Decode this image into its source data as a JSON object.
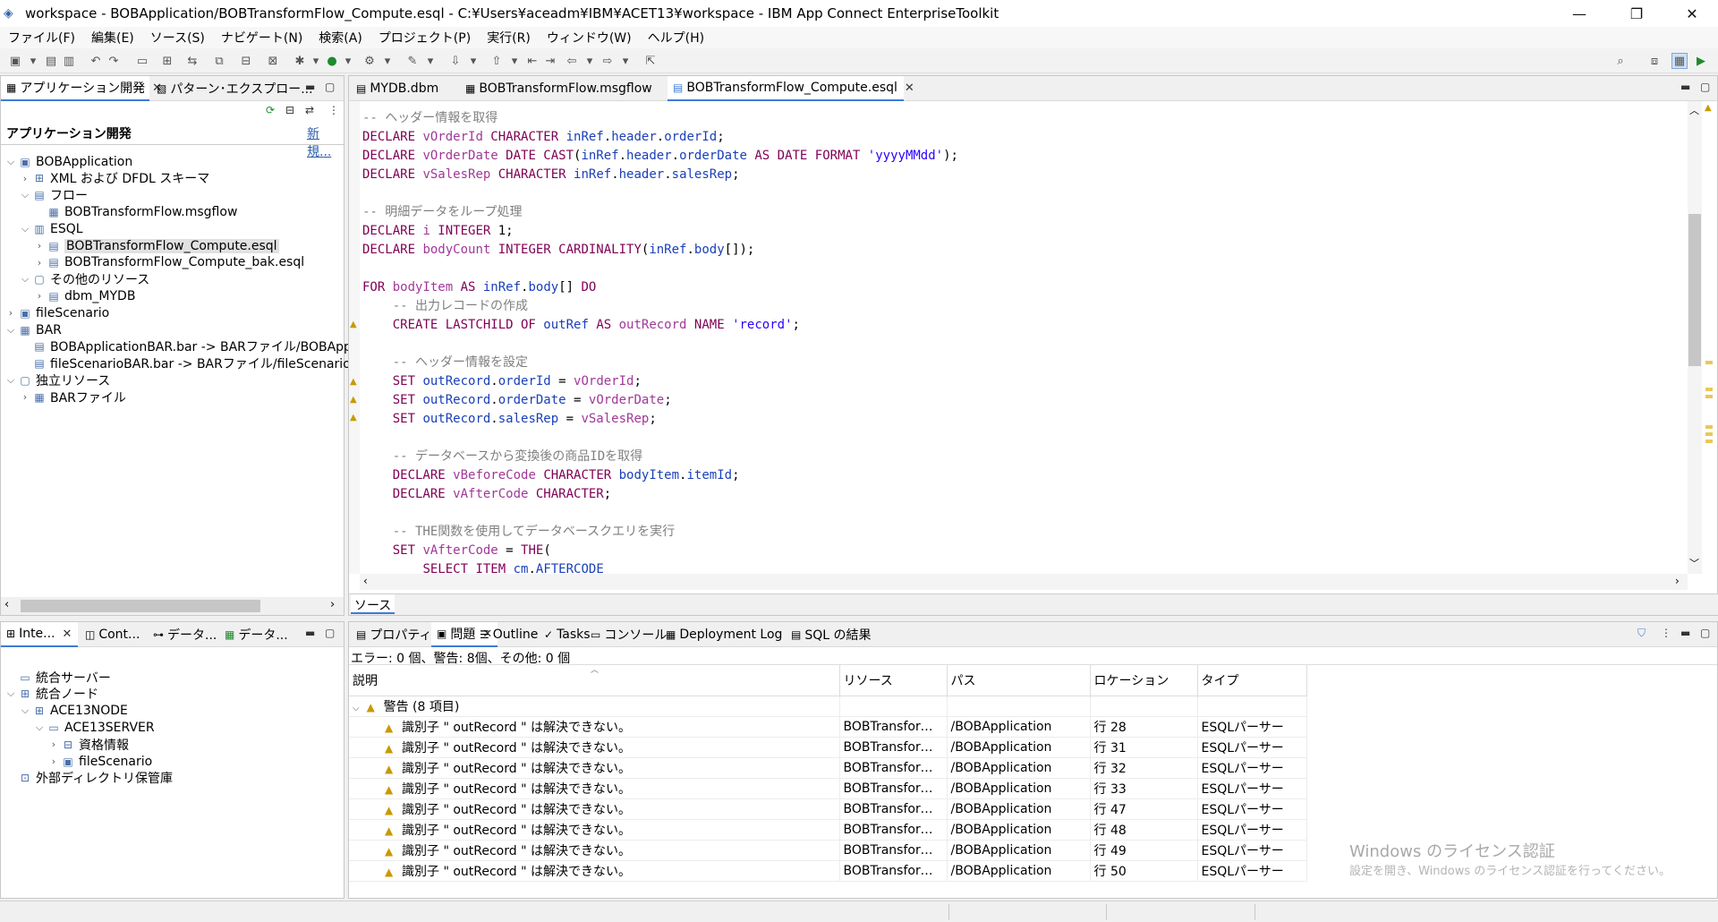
{
  "window": {
    "title": "workspace - BOBApplication/BOBTransformFlow_Compute.esql - C:¥Users¥aceadm¥IBM¥ACET13¥workspace - IBM App Connect EnterpriseToolkit",
    "minimize": "—",
    "restore": "❐",
    "close": "✕"
  },
  "menu": [
    "ファイル(F)",
    "編集(E)",
    "ソース(S)",
    "ナビゲート(N)",
    "検索(A)",
    "プロジェクト(P)",
    "実行(R)",
    "ウィンドウ(W)",
    "ヘルプ(H)"
  ],
  "left_top": {
    "tabs": [
      {
        "label": "アプリケーション開発",
        "icon": "app-dev-icon"
      },
      {
        "label": "パターン･エクスプロー...",
        "icon": "pattern-icon"
      }
    ],
    "header": "アプリケーション開発",
    "new_link": "新規...",
    "tree": [
      {
        "label": "BOBApplication",
        "level": 0,
        "expanded": true,
        "icon": "application-icon"
      },
      {
        "label": "XML および DFDL スキーマ",
        "level": 1,
        "expanded": false,
        "icon": "schema-icon"
      },
      {
        "label": "フロー",
        "level": 1,
        "expanded": true,
        "icon": "flow-folder-icon"
      },
      {
        "label": "BOBTransformFlow.msgflow",
        "level": 2,
        "expanded": null,
        "icon": "msgflow-icon"
      },
      {
        "label": "ESQL",
        "level": 1,
        "expanded": true,
        "icon": "esql-folder-icon"
      },
      {
        "label": "BOBTransformFlow_Compute.esql",
        "level": 2,
        "expanded": false,
        "icon": "esql-file-icon",
        "selected": true
      },
      {
        "label": "BOBTransformFlow_Compute_bak.esql",
        "level": 2,
        "expanded": false,
        "icon": "esql-file-icon"
      },
      {
        "label": "その他のリソース",
        "level": 1,
        "expanded": true,
        "icon": "resource-folder-icon"
      },
      {
        "label": "dbm_MYDB",
        "level": 2,
        "expanded": false,
        "icon": "dbm-icon"
      },
      {
        "label": "fileScenario",
        "level": 0,
        "expanded": false,
        "icon": "application-icon"
      },
      {
        "label": "BAR",
        "level": 0,
        "expanded": true,
        "icon": "bar-folder-icon"
      },
      {
        "label": "BOBApplicationBAR.bar -> BARファイル/BOBApp",
        "level": 1,
        "expanded": null,
        "icon": "bar-file-icon"
      },
      {
        "label": "fileScenarioBAR.bar -> BARファイル/fileScenarioB",
        "level": 1,
        "expanded": null,
        "icon": "bar-file-icon"
      },
      {
        "label": "独立リソース",
        "level": 0,
        "expanded": true,
        "icon": "resource-folder-icon"
      },
      {
        "label": "BARファイル",
        "level": 1,
        "expanded": false,
        "icon": "bar-folder-icon"
      }
    ]
  },
  "left_bottom": {
    "tabs": [
      {
        "label": "Inte...",
        "icon": "integration-icon"
      },
      {
        "label": "Cont...",
        "icon": "container-icon"
      },
      {
        "label": "データ...",
        "icon": "data-icon"
      },
      {
        "label": "データ...",
        "icon": "data2-icon"
      }
    ],
    "tree": [
      {
        "label": "統合サーバー",
        "level": 0,
        "expanded": null,
        "icon": "server-icon"
      },
      {
        "label": "統合ノード",
        "level": 0,
        "expanded": true,
        "icon": "node-icon"
      },
      {
        "label": "ACE13NODE",
        "level": 1,
        "expanded": true,
        "icon": "node-icon"
      },
      {
        "label": "ACE13SERVER",
        "level": 2,
        "expanded": true,
        "icon": "server-icon"
      },
      {
        "label": "資格情報",
        "level": 3,
        "expanded": false,
        "icon": "credentials-icon"
      },
      {
        "label": "fileScenario",
        "level": 3,
        "expanded": false,
        "icon": "application-icon"
      },
      {
        "label": "外部ディレクトリ保管庫",
        "level": 0,
        "expanded": null,
        "icon": "lock-icon"
      }
    ]
  },
  "editor": {
    "tabs": [
      {
        "label": "MYDB.dbm",
        "icon": "dbm-icon"
      },
      {
        "label": "BOBTransformFlow.msgflow",
        "icon": "msgflow-icon"
      },
      {
        "label": "BOBTransformFlow_Compute.esql",
        "icon": "esql-file-icon",
        "active": true
      }
    ],
    "bottom_tab": "ソース",
    "lines": [
      [
        [
          "cm",
          "-- ヘッダー情報を取得"
        ]
      ],
      [
        [
          "kw",
          "DECLARE "
        ],
        [
          "vr",
          "vOrderId "
        ],
        [
          "kw",
          "CHARACTER "
        ],
        [
          "id",
          "inRef"
        ],
        [
          "pl",
          "."
        ],
        [
          "id",
          "header"
        ],
        [
          "pl",
          "."
        ],
        [
          "id",
          "orderId"
        ],
        [
          "pl",
          ";"
        ]
      ],
      [
        [
          "kw",
          "DECLARE "
        ],
        [
          "vr",
          "vOrderDate "
        ],
        [
          "kw",
          "DATE CAST"
        ],
        [
          "pl",
          "("
        ],
        [
          "id",
          "inRef"
        ],
        [
          "pl",
          "."
        ],
        [
          "id",
          "header"
        ],
        [
          "pl",
          "."
        ],
        [
          "id",
          "orderDate "
        ],
        [
          "kw",
          "AS DATE FORMAT "
        ],
        [
          "st",
          "'yyyyMMdd'"
        ],
        [
          "pl",
          ");"
        ]
      ],
      [
        [
          "kw",
          "DECLARE "
        ],
        [
          "vr",
          "vSalesRep "
        ],
        [
          "kw",
          "CHARACTER "
        ],
        [
          "id",
          "inRef"
        ],
        [
          "pl",
          "."
        ],
        [
          "id",
          "header"
        ],
        [
          "pl",
          "."
        ],
        [
          "id",
          "salesRep"
        ],
        [
          "pl",
          ";"
        ]
      ],
      [],
      [
        [
          "cm",
          "-- 明細データをループ処理"
        ]
      ],
      [
        [
          "kw",
          "DECLARE "
        ],
        [
          "vr",
          "i "
        ],
        [
          "kw",
          "INTEGER "
        ],
        [
          "pl",
          "1;"
        ]
      ],
      [
        [
          "kw",
          "DECLARE "
        ],
        [
          "vr",
          "bodyCount "
        ],
        [
          "kw",
          "INTEGER CARDINALITY"
        ],
        [
          "pl",
          "("
        ],
        [
          "id",
          "inRef"
        ],
        [
          "pl",
          "."
        ],
        [
          "id",
          "body"
        ],
        [
          "pl",
          "[]);"
        ]
      ],
      [],
      [
        [
          "kw",
          "FOR "
        ],
        [
          "vr",
          "bodyItem "
        ],
        [
          "kw",
          "AS "
        ],
        [
          "id",
          "inRef"
        ],
        [
          "pl",
          "."
        ],
        [
          "id",
          "body"
        ],
        [
          "pl",
          "[] "
        ],
        [
          "kw",
          "DO"
        ]
      ],
      [
        [
          "pl",
          "    "
        ],
        [
          "cm",
          "-- 出力レコードの作成"
        ]
      ],
      [
        [
          "pl",
          "    "
        ],
        [
          "kw",
          "CREATE LASTCHILD OF "
        ],
        [
          "id",
          "outRef "
        ],
        [
          "kw",
          "AS "
        ],
        [
          "vr",
          "outRecord "
        ],
        [
          "kw",
          "NAME "
        ],
        [
          "st",
          "'record'"
        ],
        [
          "pl",
          ";"
        ]
      ],
      [],
      [
        [
          "pl",
          "    "
        ],
        [
          "cm",
          "-- ヘッダー情報を設定"
        ]
      ],
      [
        [
          "pl",
          "    "
        ],
        [
          "kw",
          "SET "
        ],
        [
          "id",
          "outRecord"
        ],
        [
          "pl",
          "."
        ],
        [
          "id",
          "orderId "
        ],
        [
          "pl",
          "= "
        ],
        [
          "vr",
          "vOrderId"
        ],
        [
          "pl",
          ";"
        ]
      ],
      [
        [
          "pl",
          "    "
        ],
        [
          "kw",
          "SET "
        ],
        [
          "id",
          "outRecord"
        ],
        [
          "pl",
          "."
        ],
        [
          "id",
          "orderDate "
        ],
        [
          "pl",
          "= "
        ],
        [
          "vr",
          "vOrderDate"
        ],
        [
          "pl",
          ";"
        ]
      ],
      [
        [
          "pl",
          "    "
        ],
        [
          "kw",
          "SET "
        ],
        [
          "id",
          "outRecord"
        ],
        [
          "pl",
          "."
        ],
        [
          "id",
          "salesRep "
        ],
        [
          "pl",
          "= "
        ],
        [
          "vr",
          "vSalesRep"
        ],
        [
          "pl",
          ";"
        ]
      ],
      [],
      [
        [
          "pl",
          "    "
        ],
        [
          "cm",
          "-- データベースから変換後の商品IDを取得"
        ]
      ],
      [
        [
          "pl",
          "    "
        ],
        [
          "kw",
          "DECLARE "
        ],
        [
          "vr",
          "vBeforeCode "
        ],
        [
          "kw",
          "CHARACTER "
        ],
        [
          "id",
          "bodyItem"
        ],
        [
          "pl",
          "."
        ],
        [
          "id",
          "itemId"
        ],
        [
          "pl",
          ";"
        ]
      ],
      [
        [
          "pl",
          "    "
        ],
        [
          "kw",
          "DECLARE "
        ],
        [
          "vr",
          "vAfterCode "
        ],
        [
          "kw",
          "CHARACTER"
        ],
        [
          "pl",
          ";"
        ]
      ],
      [],
      [
        [
          "pl",
          "    "
        ],
        [
          "cm",
          "-- THE関数を使用してデータベースクエリを実行"
        ]
      ],
      [
        [
          "pl",
          "    "
        ],
        [
          "kw",
          "SET "
        ],
        [
          "vr",
          "vAfterCode "
        ],
        [
          "pl",
          "= "
        ],
        [
          "kw",
          "THE"
        ],
        [
          "pl",
          "("
        ]
      ],
      [
        [
          "pl",
          "        "
        ],
        [
          "kw",
          "SELECT ITEM "
        ],
        [
          "id",
          "cm"
        ],
        [
          "pl",
          "."
        ],
        [
          "id",
          "AFTERCODE"
        ]
      ]
    ]
  },
  "bottom": {
    "tabs": [
      {
        "label": "プロパティー",
        "icon": "properties-icon"
      },
      {
        "label": "問題",
        "icon": "problems-icon",
        "active": true
      },
      {
        "label": "Outline",
        "icon": "outline-icon"
      },
      {
        "label": "Tasks",
        "icon": "tasks-icon"
      },
      {
        "label": "コンソール",
        "icon": "console-icon"
      },
      {
        "label": "Deployment Log",
        "icon": "log-icon"
      },
      {
        "label": "SQL の結果",
        "icon": "sql-icon"
      }
    ],
    "summary": "エラー: 0 個、警告: 8個、その他: 0 個",
    "columns": [
      "説明",
      "リソース",
      "パス",
      "ロケーション",
      "タイプ"
    ],
    "group": "警告 (8 項目)",
    "rows": [
      {
        "desc": "識別子 \" outRecord \" は解決できない。",
        "resource": "BOBTransformF...",
        "path": "/BOBApplication",
        "location": "行 28",
        "type": "ESQLパーサー"
      },
      {
        "desc": "識別子 \" outRecord \" は解決できない。",
        "resource": "BOBTransformF...",
        "path": "/BOBApplication",
        "location": "行 31",
        "type": "ESQLパーサー"
      },
      {
        "desc": "識別子 \" outRecord \" は解決できない。",
        "resource": "BOBTransformF...",
        "path": "/BOBApplication",
        "location": "行 32",
        "type": "ESQLパーサー"
      },
      {
        "desc": "識別子 \" outRecord \" は解決できない。",
        "resource": "BOBTransformF...",
        "path": "/BOBApplication",
        "location": "行 33",
        "type": "ESQLパーサー"
      },
      {
        "desc": "識別子 \" outRecord \" は解決できない。",
        "resource": "BOBTransformF...",
        "path": "/BOBApplication",
        "location": "行 47",
        "type": "ESQLパーサー"
      },
      {
        "desc": "識別子 \" outRecord \" は解決できない。",
        "resource": "BOBTransformF...",
        "path": "/BOBApplication",
        "location": "行 48",
        "type": "ESQLパーサー"
      },
      {
        "desc": "識別子 \" outRecord \" は解決できない。",
        "resource": "BOBTransformF...",
        "path": "/BOBApplication",
        "location": "行 49",
        "type": "ESQLパーサー"
      },
      {
        "desc": "識別子 \" outRecord \" は解決できない。",
        "resource": "BOBTransformF...",
        "path": "/BOBApplication",
        "location": "行 50",
        "type": "ESQLパーサー"
      }
    ]
  },
  "watermark": {
    "title": "Windows のライセンス認証",
    "sub": "設定を開き、Windows のライセンス認証を行ってください。"
  },
  "colors": {
    "keyword": "#7f0055",
    "variable": "#a03898",
    "identifier": "#1a3fb8",
    "string": "#2a00ff",
    "comment": "#7f7f7f",
    "warning": "#c89a00",
    "accent": "#3d7bd6"
  }
}
